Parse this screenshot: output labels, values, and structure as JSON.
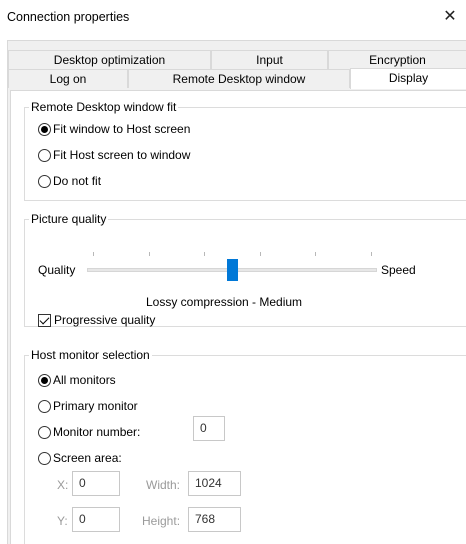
{
  "window": {
    "title": "Connection properties",
    "close_glyph": "✕"
  },
  "tabs_row1": [
    {
      "label": "Desktop optimization"
    },
    {
      "label": "Input"
    },
    {
      "label": "Encryption"
    }
  ],
  "tabs_row2": [
    {
      "label": "Log on"
    },
    {
      "label": "Remote Desktop window"
    },
    {
      "label": "Display",
      "active": true
    }
  ],
  "window_fit": {
    "legend": "Remote Desktop window fit",
    "options": [
      {
        "label": "Fit window to Host screen",
        "checked": true
      },
      {
        "label": "Fit Host screen to window",
        "checked": false
      },
      {
        "label": "Do not fit",
        "checked": false
      }
    ]
  },
  "picture_quality": {
    "legend": "Picture quality",
    "left_label": "Quality",
    "right_label": "Speed",
    "slider_position": 0.5,
    "tick_count": 6,
    "caption": "Lossy compression - Medium",
    "progressive_label": "Progressive quality",
    "progressive_checked": true
  },
  "monitor_selection": {
    "legend": "Host monitor selection",
    "all_monitors": "All monitors",
    "primary_monitor": "Primary monitor",
    "monitor_number": "Monitor number:",
    "monitor_number_value": "0",
    "screen_area": "Screen area:",
    "selected": "all_monitors",
    "x_label": "X:",
    "x_value": "0",
    "y_label": "Y:",
    "y_value": "0",
    "width_label": "Width:",
    "width_value": "1024",
    "height_label": "Height:",
    "height_value": "768"
  },
  "colors": {
    "accent": "#0078d7",
    "panel_bg": "#ffffff",
    "dialog_bg": "#f0f0f0"
  },
  "icons": {
    "close": "close-icon"
  }
}
